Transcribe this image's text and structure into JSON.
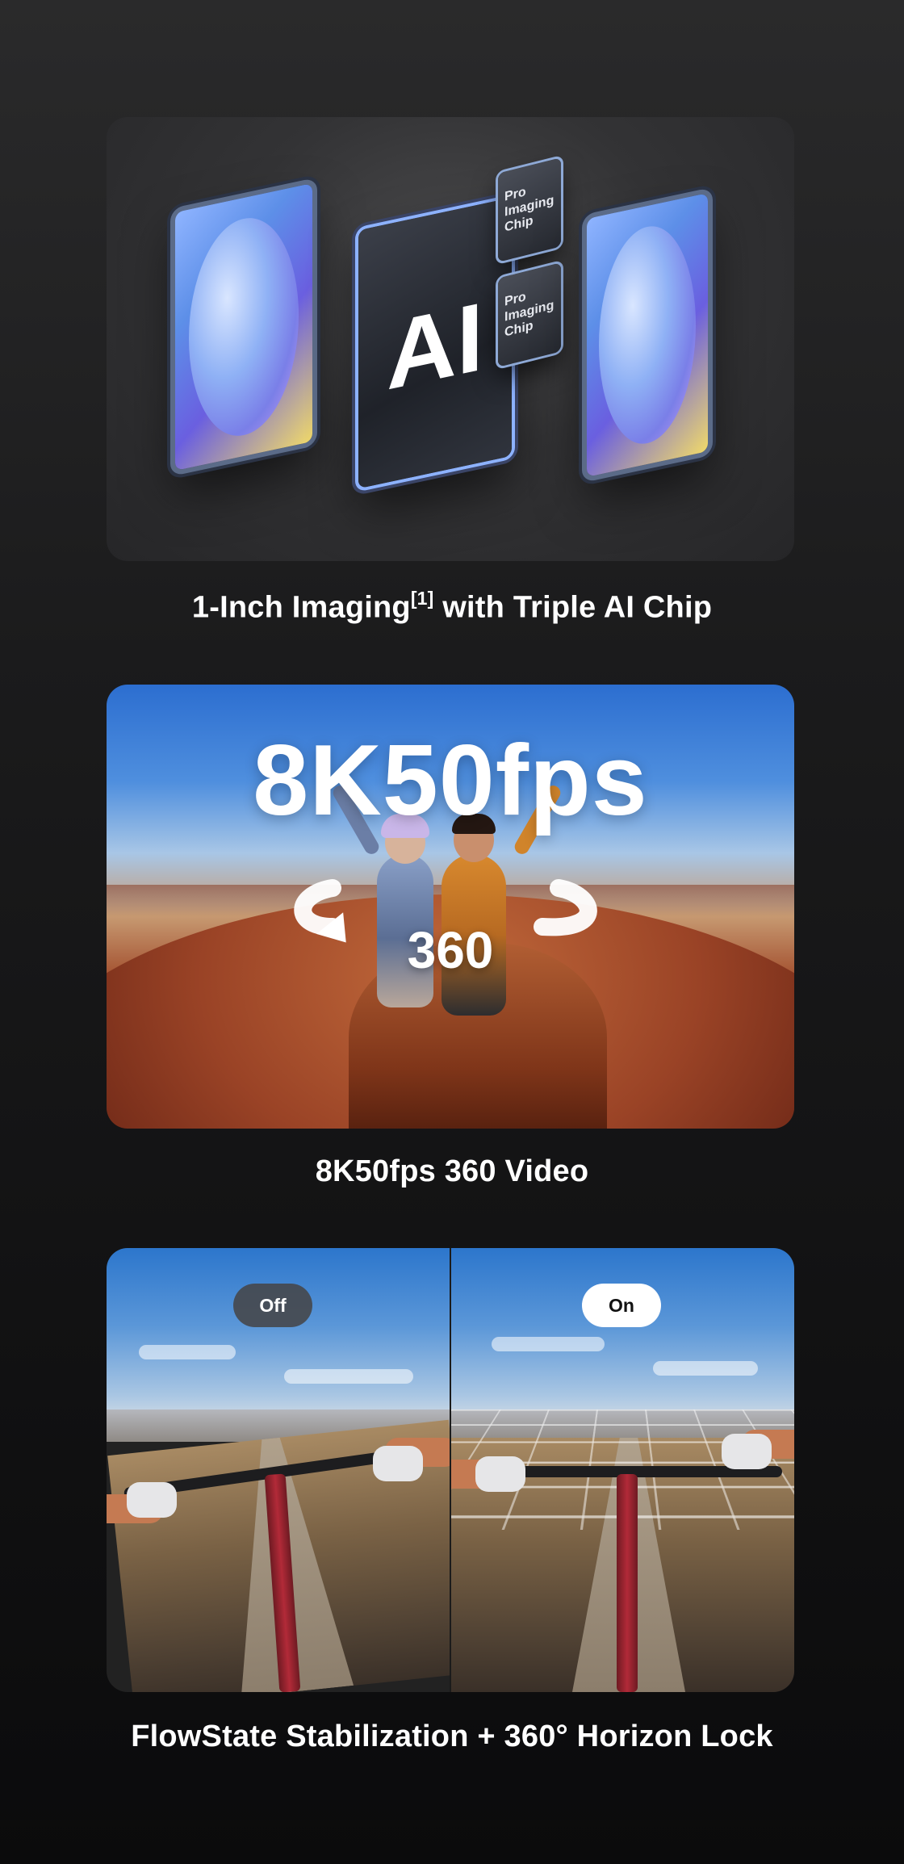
{
  "features": [
    {
      "caption_main": "1-Inch Imaging",
      "caption_sup": "[1]",
      "caption_rest": " with Triple AI Chip",
      "chip_label": "AI",
      "small_chip_label": "Pro Imaging Chip"
    },
    {
      "headline": "8K50fps",
      "overlay_label": "360",
      "caption": "8K50fps 360 Video"
    },
    {
      "off_label": "Off",
      "on_label": "On",
      "caption": "FlowState Stabilization + 360° Horizon Lock"
    }
  ]
}
